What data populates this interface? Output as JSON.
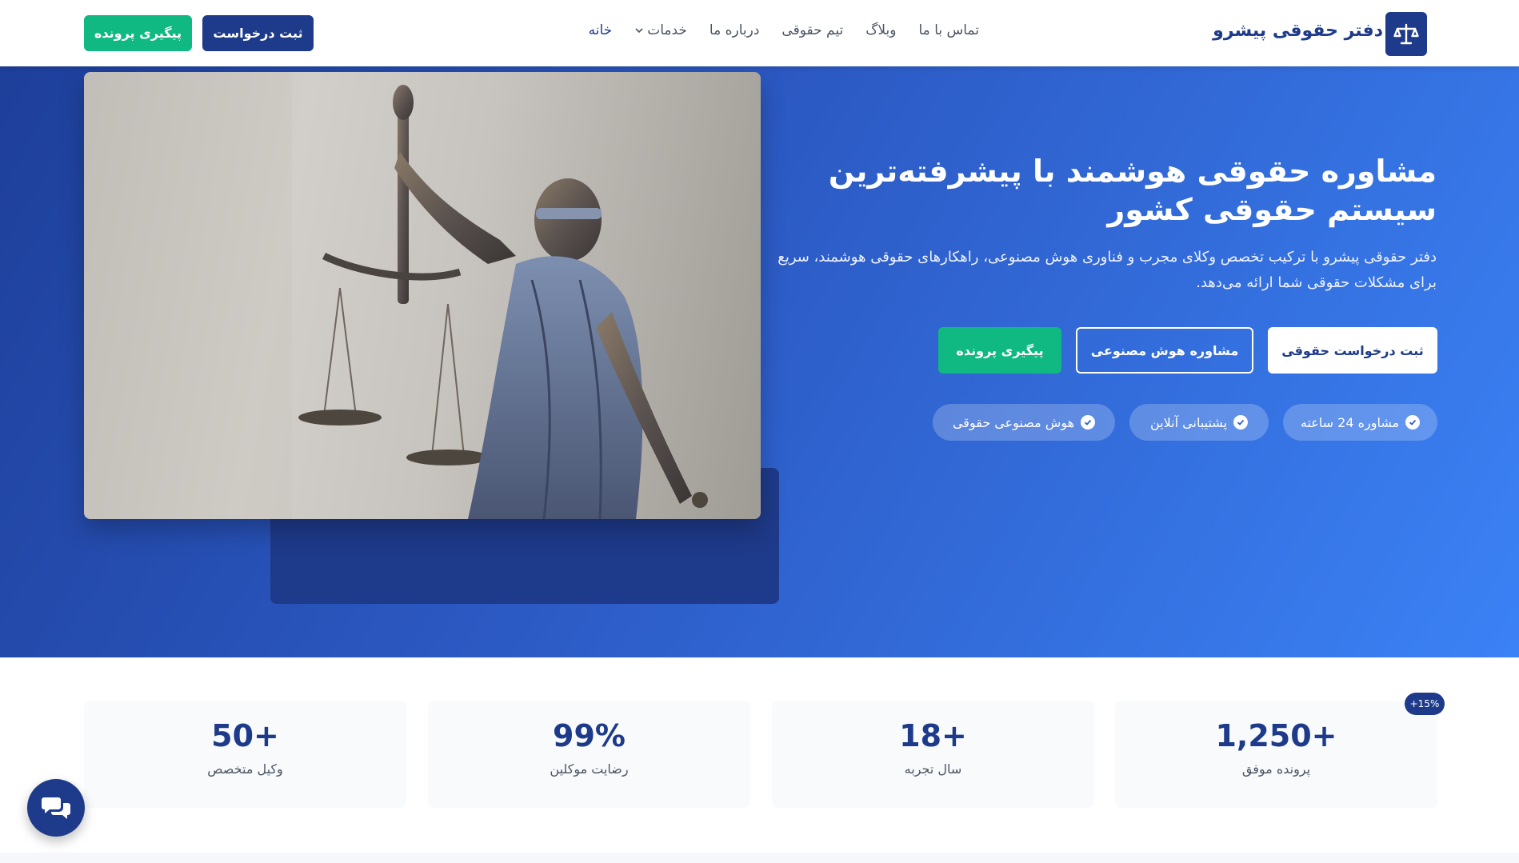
{
  "header": {
    "logo_text": "دفتر حقوقی پیشرو",
    "logo_icon": "scales-icon",
    "nav": [
      {
        "label": "خانه",
        "active": true
      },
      {
        "label": "خدمات",
        "dropdown": true
      },
      {
        "label": "درباره ما"
      },
      {
        "label": "تیم حقوقی"
      },
      {
        "label": "وبلاگ"
      },
      {
        "label": "تماس با ما"
      }
    ],
    "submit_button": "ثبت درخواست",
    "track_button": "پیگیری پرونده"
  },
  "hero": {
    "title": "مشاوره حقوقی هوشمند با پیشرفته‌ترین سیستم حقوقی کشور",
    "description": "دفتر حقوقی پیشرو با ترکیب تخصص وکلای مجرب و فناوری هوش مصنوعی، راهکارهای حقوقی هوشمند، سریع برای مشکلات حقوقی شما ارائه می‌دهد.",
    "buttons": {
      "request": "ثبت درخواست حقوقی",
      "ai_consult": "مشاوره هوش مصنوعی",
      "track": "پیگیری پرونده"
    },
    "features": [
      "مشاوره 24 ساعته",
      "پشتیبانی آنلاین",
      "هوش مصنوعی حقوقی"
    ],
    "image_alt": "lady-justice-statue"
  },
  "stats": [
    {
      "value": "1,250+",
      "label": "پرونده موفق",
      "badge": "+15%"
    },
    {
      "value": "18+",
      "label": "سال تجربه"
    },
    {
      "value": "99%",
      "label": "رضایت موکلین"
    },
    {
      "value": "50+",
      "label": "وکیل متخصص"
    }
  ],
  "colors": {
    "primary": "#1e3a8a",
    "accent_green": "#10b981",
    "hero_gradient_end": "#3b82f6"
  },
  "chat_icon": "chat-bubbles-icon"
}
